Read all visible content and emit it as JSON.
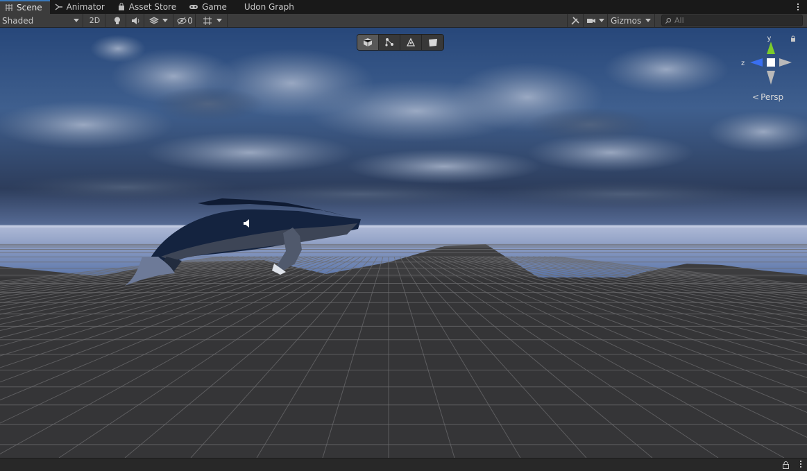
{
  "tabs": [
    {
      "label": "Scene",
      "icon": "grid-icon",
      "active": true
    },
    {
      "label": "Animator",
      "icon": "animator-icon",
      "active": false
    },
    {
      "label": "Asset Store",
      "icon": "bag-icon",
      "active": false
    },
    {
      "label": "Game",
      "icon": "gamepad-icon",
      "active": false
    },
    {
      "label": "Udon Graph",
      "icon": "",
      "active": false
    }
  ],
  "toolbar": {
    "draw_mode": "Shaded",
    "mode_2d": "2D",
    "hidden_count": "0",
    "gizmos_label": "Gizmos",
    "search_placeholder": "All"
  },
  "gizmo": {
    "projection": "Persp",
    "axis_y": "y",
    "axis_z": "z"
  },
  "colors": {
    "accent": "#3a79bb",
    "panel": "#3c3c3c",
    "tab_bar": "#191919",
    "axis_y": "#7ccc2a",
    "axis_z": "#3a6ff0",
    "sky_top": "#2a4a7a",
    "sea": "#8fa2c8",
    "ground": "#3a3a3c"
  }
}
